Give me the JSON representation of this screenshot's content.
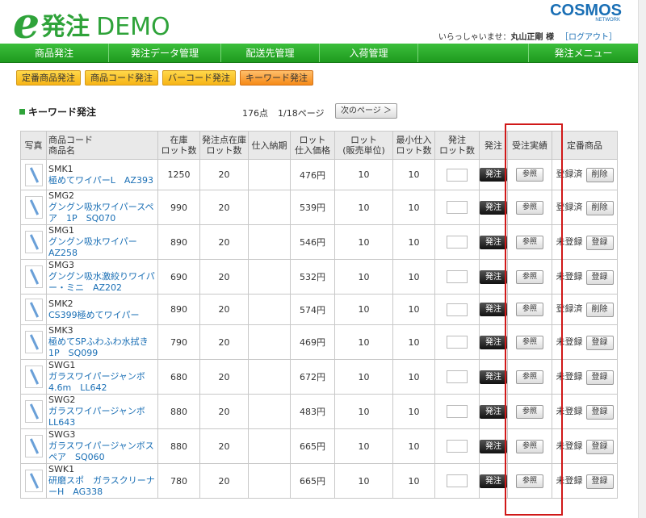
{
  "header": {
    "logo_e": "e",
    "logo_text": "発注",
    "logo_demo": "DEMO",
    "company": "COSMOS",
    "company_sub": "NETWORK",
    "welcome_prefix": "いらっしゃいませ：",
    "user": "丸山正剛 様",
    "logout": "［ログアウト］"
  },
  "nav": {
    "items": [
      "商品発注",
      "発注データ管理",
      "配送先管理",
      "入荷管理"
    ],
    "menu": "発注メニュー"
  },
  "subtabs": [
    "定番商品発注",
    "商品コード発注",
    "バーコード発注",
    "キーワード発注"
  ],
  "page": {
    "title": "キーワード発注",
    "count": "176点",
    "pages": "1/18ページ",
    "next": "次のページ ＞"
  },
  "table": {
    "headers": {
      "photo": "写真",
      "code1": "商品コード",
      "code2": "商品名",
      "stock1": "在庫",
      "stock2": "ロット数",
      "reorder1": "発注点在庫",
      "reorder2": "ロット数",
      "delivery": "仕入納期",
      "lotprice1": "ロット",
      "lotprice2": "仕入価格",
      "lotunit1": "ロット",
      "lotunit2": "(販売単位)",
      "minlot1": "最小仕入",
      "minlot2": "ロット数",
      "orderlot1": "発注",
      "orderlot2": "ロット数",
      "order": "発注",
      "history": "受注実績",
      "standard": "定番商品"
    },
    "order_btn": "発注",
    "ref_btn": "参照",
    "rows": [
      {
        "code": "SMK1",
        "name": "極めてワイパーL　AZ393",
        "stock": "1250",
        "reorder": "20",
        "delivery": "",
        "price": "476円",
        "lot": "10",
        "minlot": "10",
        "status": "登録済",
        "action": "削除"
      },
      {
        "code": "SMG2",
        "name": "グングン吸水ワイパースペア　1P　SQ070",
        "stock": "990",
        "reorder": "20",
        "delivery": "",
        "price": "539円",
        "lot": "10",
        "minlot": "10",
        "status": "登録済",
        "action": "削除"
      },
      {
        "code": "SMG1",
        "name": "グングン吸水ワイパー　AZ258",
        "stock": "890",
        "reorder": "20",
        "delivery": "",
        "price": "546円",
        "lot": "10",
        "minlot": "10",
        "status": "未登録",
        "action": "登録"
      },
      {
        "code": "SMG3",
        "name": "グングン吸水激絞りワイパー・ミニ　AZ202",
        "stock": "690",
        "reorder": "20",
        "delivery": "",
        "price": "532円",
        "lot": "10",
        "minlot": "10",
        "status": "未登録",
        "action": "登録"
      },
      {
        "code": "SMK2",
        "name": "CS399極めてワイパー",
        "stock": "890",
        "reorder": "20",
        "delivery": "",
        "price": "574円",
        "lot": "10",
        "minlot": "10",
        "status": "登録済",
        "action": "削除"
      },
      {
        "code": "SMK3",
        "name": "極めてSPふわふわ水拭き1P　SQ099",
        "stock": "790",
        "reorder": "20",
        "delivery": "",
        "price": "469円",
        "lot": "10",
        "minlot": "10",
        "status": "未登録",
        "action": "登録"
      },
      {
        "code": "SWG1",
        "name": "ガラスワイパージャンボ4.6m　LL642",
        "stock": "680",
        "reorder": "20",
        "delivery": "",
        "price": "672円",
        "lot": "10",
        "minlot": "10",
        "status": "未登録",
        "action": "登録"
      },
      {
        "code": "SWG2",
        "name": "ガラスワイパージャンボLL643",
        "stock": "880",
        "reorder": "20",
        "delivery": "",
        "price": "483円",
        "lot": "10",
        "minlot": "10",
        "status": "未登録",
        "action": "登録"
      },
      {
        "code": "SWG3",
        "name": "ガラスワイパージャンボスペア　SQ060",
        "stock": "880",
        "reorder": "20",
        "delivery": "",
        "price": "665円",
        "lot": "10",
        "minlot": "10",
        "status": "未登録",
        "action": "登録"
      },
      {
        "code": "SWK1",
        "name": "研磨スポ　ガラスクリーナーH　AG338",
        "stock": "780",
        "reorder": "20",
        "delivery": "",
        "price": "665円",
        "lot": "10",
        "minlot": "10",
        "status": "未登録",
        "action": "登録"
      }
    ]
  },
  "colors": {
    "brand_green": "#2fa33a",
    "nav_green": "#1e9a1e",
    "link_blue": "#1a6fb5",
    "tab_yellow": "#f7b416",
    "tab_active": "#f68a18",
    "highlight_red": "#d01818"
  }
}
